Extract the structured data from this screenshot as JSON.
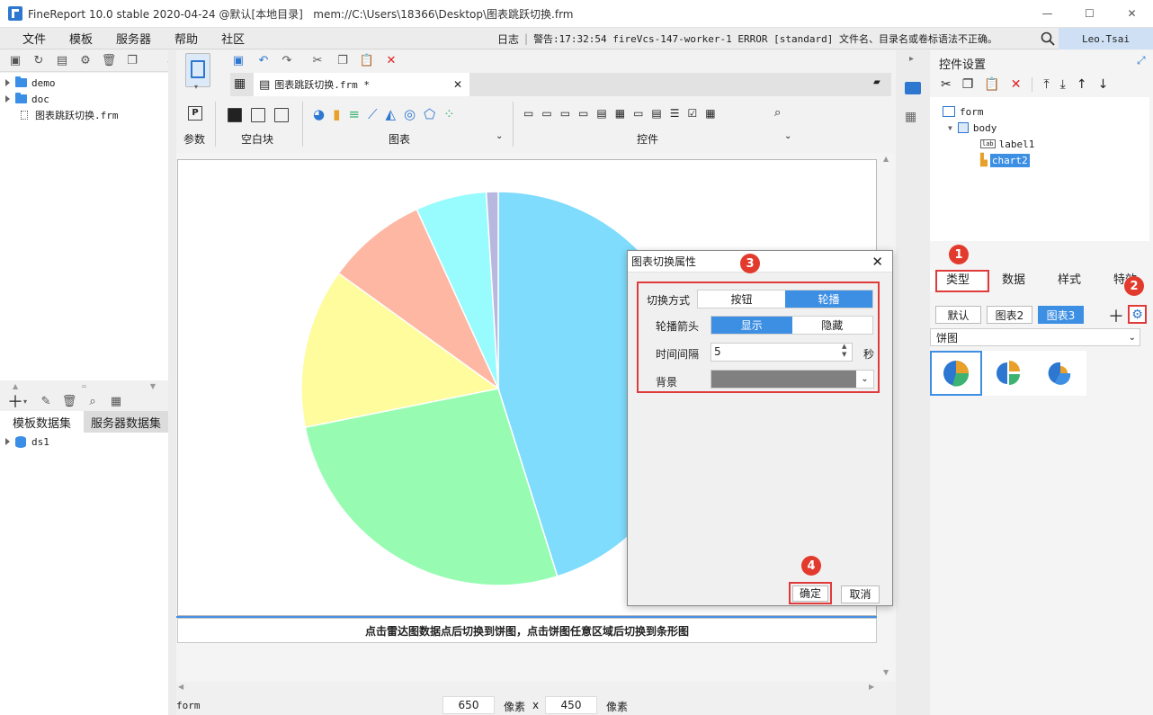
{
  "window": {
    "title": "FineReport 10.0 stable 2020-04-24 @默认[本地目录]   mem://C:\\Users\\18366\\Desktop\\图表跳跃切换.frm",
    "minimize": "—",
    "maximize": "☐",
    "close": "✕"
  },
  "menubar": {
    "items": [
      "文件",
      "模板",
      "服务器",
      "帮助",
      "社区"
    ],
    "log_label": "日志",
    "warning_text": "警告:17:32:54 fireVcs-147-worker-1 ERROR [standard] 文件名、目录名或卷标语法不正确。",
    "user": "Leo.Tsai"
  },
  "file_tree": {
    "items": [
      "demo",
      "doc",
      "图表跳跃切换.frm"
    ]
  },
  "dataset_panel": {
    "tab_template": "模板数据集",
    "tab_server": "服务器数据集",
    "items": [
      "ds1"
    ]
  },
  "editor_tab": {
    "label": "图表跳跃切换.frm *"
  },
  "toolbar": {
    "group_param": "参数",
    "group_blank": "空白块",
    "group_chart": "图表",
    "group_widget": "控件"
  },
  "canvas": {
    "label_text": "点击雷达图数据点后切换到饼图，点击饼图任意区域后切换到条形图"
  },
  "pie_chart": {
    "type": "pie",
    "values": [
      46.5,
      27.5,
      13.5,
      8.5,
      6.0,
      1.0
    ],
    "colors": [
      "#7fdcfc",
      "#97fcb2",
      "#fefc9c",
      "#feb7a3",
      "#98fbfe",
      "#b7b7e0"
    ]
  },
  "statusbar": {
    "form_label": "form",
    "width": "650",
    "unit1": "像素",
    "x": "x",
    "height": "450",
    "unit2": "像素"
  },
  "right_panel": {
    "title": "控件设置",
    "tree": [
      "form",
      "body",
      "label1",
      "chart2"
    ],
    "tabs": [
      "类型",
      "数据",
      "样式",
      "特效"
    ],
    "chart_tabs": [
      "默认",
      "图表2",
      "图表3"
    ],
    "chart_type_select": "饼图"
  },
  "dialog": {
    "title": "图表切换属性",
    "switch_mode_label": "切换方式",
    "switch_mode_options": [
      "按钮",
      "轮播"
    ],
    "arrow_label": "轮播箭头",
    "arrow_options": [
      "显示",
      "隐藏"
    ],
    "interval_label": "时间间隔",
    "interval_value": "5",
    "interval_unit": "秒",
    "bg_label": "背景",
    "ok": "确定",
    "cancel": "取消"
  },
  "annotations": [
    "1",
    "2",
    "3",
    "4"
  ]
}
